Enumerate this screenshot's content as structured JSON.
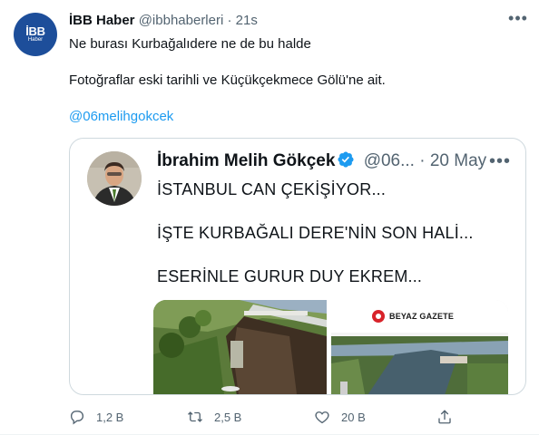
{
  "tweet": {
    "author_name": "İBB Haber",
    "handle": "@ibbhaberleri",
    "dot": "·",
    "time": "21s",
    "avatar_logo_main": "İBB",
    "avatar_logo_sub": "Haber",
    "more": "•••",
    "line1": "Ne burası Kurbağalıdere ne de bu halde",
    "line2": "Fotoğraflar eski tarihli ve Küçükçekmece Gölü'ne ait.",
    "mention": "@06melihgokcek"
  },
  "quoted": {
    "author_name": "İbrahim Melih Gökçek",
    "handle": "@06...",
    "dot": "·",
    "time": "20 May",
    "more": "•••",
    "line1": "İSTANBUL CAN ÇEKİŞİYOR...",
    "line2": "İŞTE KURBAĞALI DERE'NİN SON HALİ...",
    "line3": "ESERİNLE GURUR DUY EKREM...",
    "photo_right_logo": "BEYAZ GAZETE"
  },
  "actions": {
    "reply_count": "1,2 B",
    "retweet_count": "2,5 B",
    "like_count": "20 B"
  },
  "colors": {
    "link": "#1d9bf0",
    "secondary": "#536471",
    "verified": "#1d9bf0",
    "avatar_bg": "#1d4e9a"
  }
}
